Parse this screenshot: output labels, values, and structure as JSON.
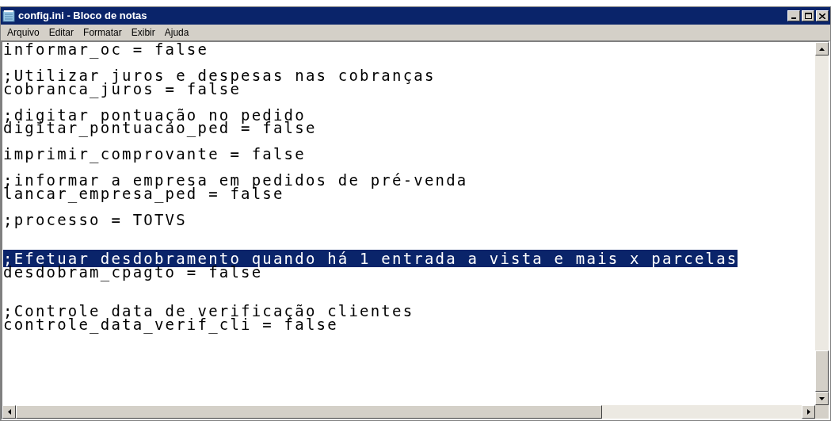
{
  "window": {
    "title": "config.ini - Bloco de notas"
  },
  "menu": [
    "Arquivo",
    "Editar",
    "Formatar",
    "Exibir",
    "Ajuda"
  ],
  "lines": [
    {
      "kind": "text",
      "text": "informar_oc = false",
      "selected": false
    },
    {
      "kind": "blank"
    },
    {
      "kind": "text",
      "text": ";Utilizar juros e despesas nas cobranças",
      "selected": false
    },
    {
      "kind": "text",
      "text": "cobranca_juros = false",
      "selected": false
    },
    {
      "kind": "blank"
    },
    {
      "kind": "text",
      "text": ";digitar pontuação no pedido",
      "selected": false
    },
    {
      "kind": "text",
      "text": "digitar_pontuacao_ped = false",
      "selected": false
    },
    {
      "kind": "blank"
    },
    {
      "kind": "text",
      "text": "imprimir_comprovante = false",
      "selected": false
    },
    {
      "kind": "blank"
    },
    {
      "kind": "text",
      "text": ";informar a empresa em pedidos de pré-venda",
      "selected": false
    },
    {
      "kind": "text",
      "text": "lancar_empresa_ped = false",
      "selected": false
    },
    {
      "kind": "blank"
    },
    {
      "kind": "text",
      "text": ";processo = TOTVS",
      "selected": false
    },
    {
      "kind": "blank"
    },
    {
      "kind": "blank"
    },
    {
      "kind": "text",
      "text": ";Efetuar desdobramento quando há 1 entrada a vista e mais x parcelas",
      "selected": true
    },
    {
      "kind": "text",
      "text": "desdobram_cpagto = false",
      "selected": false
    },
    {
      "kind": "blank"
    },
    {
      "kind": "blank"
    },
    {
      "kind": "text",
      "text": ";Controle data de verificação clientes",
      "selected": false
    },
    {
      "kind": "text",
      "text": "controle_data_verif_cli = false",
      "selected": false
    }
  ]
}
